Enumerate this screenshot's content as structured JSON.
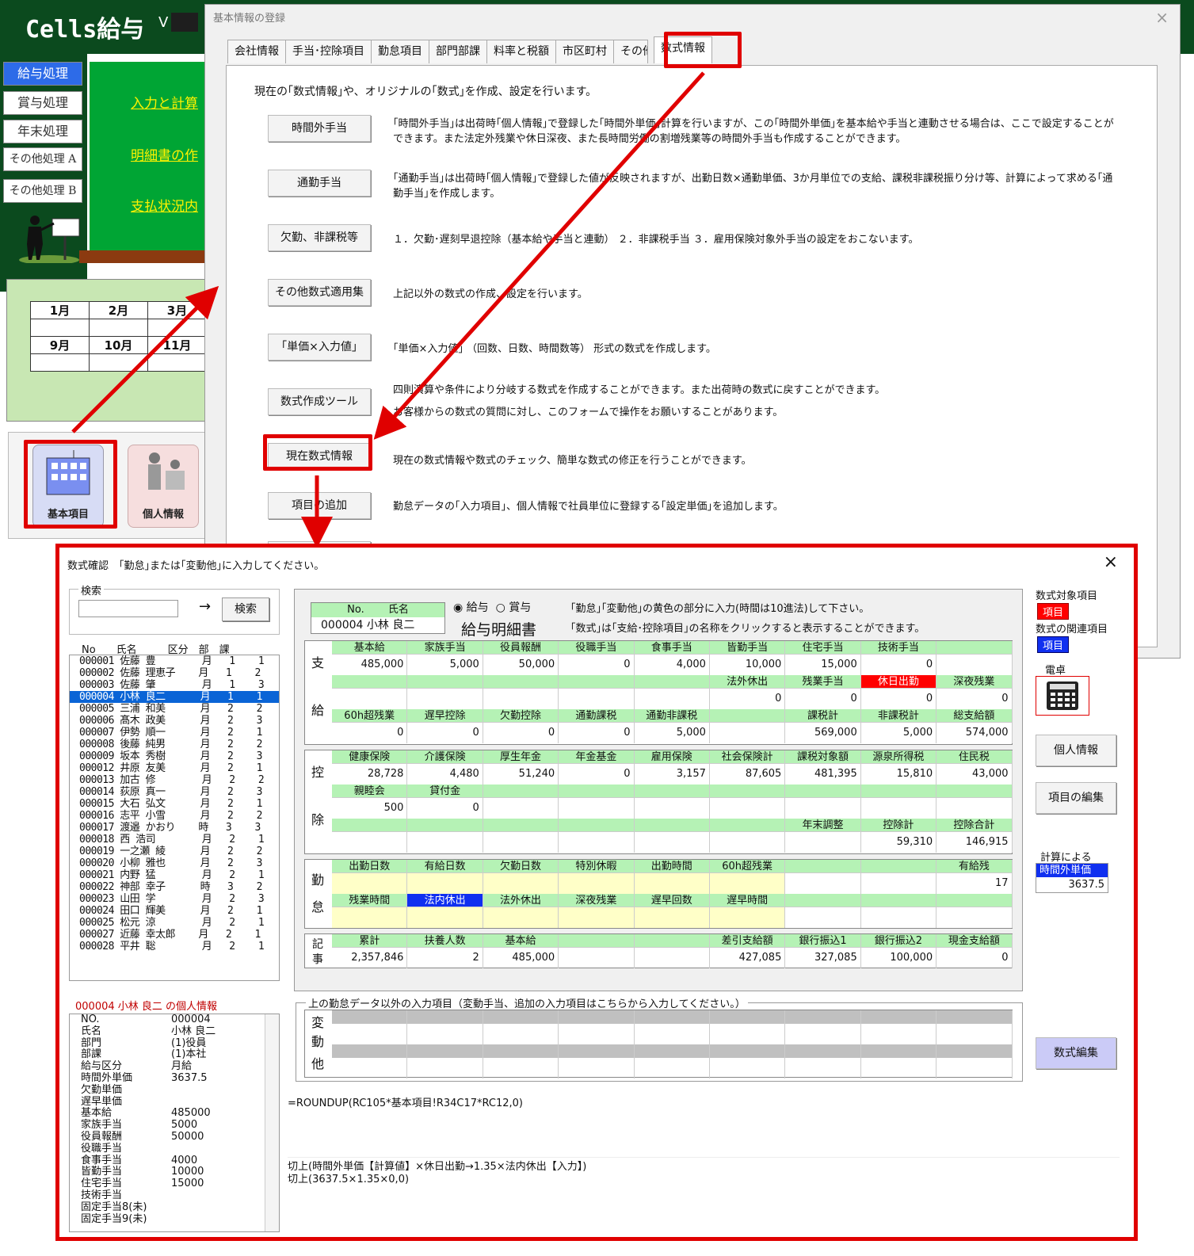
{
  "background_app": {
    "title": "Cells給与",
    "version": "V",
    "menu": [
      "給与処理",
      "賞与処理",
      "年末処理",
      "その他処理 A",
      "その他処理 B"
    ],
    "links": [
      "入力と計算",
      "明細書の作",
      "支払状況内"
    ],
    "calendar": {
      "row1": [
        "1月",
        "2月",
        "3月"
      ],
      "row2": [
        "9月",
        "10月",
        "11月"
      ]
    },
    "icons": {
      "kihon": "基本項目",
      "kojin": "個人情報"
    }
  },
  "dialog_main": {
    "title": "基本情報の登録",
    "close": "×",
    "tabs": [
      "会社情報",
      "手当･控除項目",
      "勤怠項目",
      "部門部課",
      "料率と税額",
      "市区町村",
      "その他",
      "数式情報"
    ],
    "intro": "現在の｢数式情報｣や、オリジナルの｢数式｣を作成、設定を行います。",
    "rows": [
      {
        "button": "時間外手当",
        "desc": "｢時間外手当｣は出荷時｢個人情報｣で登録した｢時間外単価｣計算を行いますが、この｢時間外単価｣を基本給や手当と連動させる場合は、ここで設定することができます。また法定外残業や休日深夜、また長時間労働の割増残業等の時間外手当も作成することができます。"
      },
      {
        "button": "通勤手当",
        "desc": "｢通勤手当｣は出荷時｢個人情報｣で登録した値が反映されますが、出勤日数×通勤単価、3か月単位での支給、課税非課税振り分け等、計算によって求める｢通勤手当｣を作成します。"
      },
      {
        "button": "欠勤、非課税等",
        "desc": "１．欠勤･遅刻早退控除（基本給や手当と連動） ２．非課税手当 ３．雇用保険対象外手当の設定をおこないます。"
      },
      {
        "button": "その他数式適用集",
        "desc": "上記以外の数式の作成、設定を行います。"
      },
      {
        "button": "｢単価×入力値｣",
        "desc": "｢単価×入力値｣ （回数、日数、時間数等） 形式の数式を作成します。"
      },
      {
        "button": "数式作成ツール",
        "desc": "四則演算や条件により分岐する数式を作成することができます。また出荷時の数式に戻すことができます。",
        "desc2": "お客様からの数式の質問に対し、このフォームで操作をお願いすることがあります。"
      },
      {
        "button": "現在数式情報",
        "desc": "現在の数式情報や数式のチェック、簡単な数式の修正を行うことができます。"
      },
      {
        "button": "項目の追加",
        "desc": "勤怠データの｢入力項目｣、個人情報で社員単位に登録する｢設定単価｣を追加します。"
      }
    ]
  },
  "dialog_formula": {
    "title": "数式確認　｢勤怠｣または｢変動他｣に入力してください。",
    "close": "×",
    "search": {
      "label": "検索",
      "arrow": "→",
      "button": "検索",
      "value": ""
    },
    "list_header": "No　　氏名　　　区分　部　課",
    "employees": [
      "000001 佐藤 豊        月   1    1",
      "000002 佐藤 理恵子    月   1    2",
      "000003 佐藤 肇        月   1    3",
      "000004 小林 良二      月   1    1",
      "000005 三浦 和美      月   2    2",
      "000006 髙木 政美      月   2    3",
      "000007 伊勢 順一      月   2    1",
      "000008 後藤 純男      月   2    2",
      "000009 坂本 秀樹      月   2    3",
      "000012 井原 友美      月   2    1",
      "000013 加古 修        月   2    2",
      "000014 荻原 真一      月   2    3",
      "000015 大石 弘文      月   2    1",
      "000016 志平 小雪      月   2    2",
      "000017 渡邉 かおり    時   3    3",
      "000018 西 浩司        月   2    1",
      "000019 一之瀬 綾      月   2    2",
      "000020 小柳 雅也      月   2    3",
      "000021 内野 猛        月   2    1",
      "000022 神部 幸子      時   3    2",
      "000023 山田 学        月   2    3",
      "000024 田口 輝美      月   2    1",
      "000025 松元 涼        月   2    1",
      "000027 近藤 幸太郎    月   2    1",
      "000028 平井 聡        月   2    1"
    ],
    "selected_index": 3,
    "person_title": "000004 小林 良二 の個人情報",
    "person_info": [
      [
        "NO.",
        "000004"
      ],
      [
        "氏名",
        "小林 良二"
      ],
      [
        "部門",
        "(1)役員"
      ],
      [
        "部課",
        "(1)本社"
      ],
      [
        "給与区分",
        "月給"
      ],
      [
        "時間外単価",
        "3637.5"
      ],
      [
        "欠勤単価",
        ""
      ],
      [
        "遅早単価",
        ""
      ],
      [
        "基本給",
        "485000"
      ],
      [
        "家族手当",
        "5000"
      ],
      [
        "役員報酬",
        "50000"
      ],
      [
        "役職手当",
        ""
      ],
      [
        "食事手当",
        "4000"
      ],
      [
        "皆勤手当",
        "10000"
      ],
      [
        "住宅手当",
        "15000"
      ],
      [
        "技術手当",
        ""
      ],
      [
        "固定手当8(未)",
        ""
      ],
      [
        "固定手当9(未)",
        ""
      ]
    ],
    "slip": {
      "no_header": "No.　　 氏名",
      "no_value": "000004 小林 良二",
      "radio_salary": "給与",
      "radio_bonus": "賞与",
      "title": "給与明細書",
      "note1": "｢勤怠｣｢変動他｣の黄色の部分に入力(時間は10進法)して下さい。",
      "note2": "｢数式｣は｢支給･控除項目｣の名称をクリックすると表示することができます。",
      "shikyu_label": [
        "支",
        "給"
      ],
      "shikyu": [
        [
          [
            "基本給",
            "485,000"
          ],
          [
            "家族手当",
            "5,000"
          ],
          [
            "役員報酬",
            "50,000"
          ],
          [
            "役職手当",
            "0"
          ],
          [
            "食事手当",
            "4,000"
          ],
          [
            "皆勤手当",
            "10,000"
          ],
          [
            "住宅手当",
            "15,000"
          ],
          [
            "技術手当",
            "0"
          ],
          [
            "",
            ""
          ]
        ],
        [
          [
            "",
            ""
          ],
          [
            "",
            ""
          ],
          [
            "",
            ""
          ],
          [
            "",
            ""
          ],
          [
            "",
            ""
          ],
          [
            "法外休出",
            "0"
          ],
          [
            "残業手当",
            "0"
          ],
          [
            "休日出勤",
            "0"
          ],
          [
            "深夜残業",
            "0"
          ]
        ],
        [
          [
            "60h超残業",
            "0"
          ],
          [
            "遅早控除",
            "0"
          ],
          [
            "欠勤控除",
            "0"
          ],
          [
            "通勤課税",
            "0"
          ],
          [
            "通勤非課税",
            "5,000"
          ],
          [
            "",
            ""
          ],
          [
            "課税計",
            "569,000"
          ],
          [
            "非課税計",
            "5,000"
          ],
          [
            "総支給額",
            "574,000"
          ]
        ]
      ],
      "kojo_label": [
        "控",
        "除"
      ],
      "kojo": [
        [
          [
            "健康保険",
            "28,728"
          ],
          [
            "介護保険",
            "4,480"
          ],
          [
            "厚生年金",
            "51,240"
          ],
          [
            "年金基金",
            "0"
          ],
          [
            "雇用保険",
            "3,157"
          ],
          [
            "社会保険計",
            "87,605"
          ],
          [
            "課税対象額",
            "481,395"
          ],
          [
            "源泉所得税",
            "15,810"
          ],
          [
            "住民税",
            "43,000"
          ]
        ],
        [
          [
            "親睦会",
            "500"
          ],
          [
            "貸付金",
            "0"
          ],
          [
            "",
            ""
          ],
          [
            "",
            ""
          ],
          [
            "",
            ""
          ],
          [
            "",
            ""
          ],
          [
            "",
            ""
          ],
          [
            "",
            ""
          ],
          [
            "",
            ""
          ]
        ],
        [
          [
            "",
            ""
          ],
          [
            "",
            ""
          ],
          [
            "",
            ""
          ],
          [
            "",
            ""
          ],
          [
            "",
            ""
          ],
          [
            "",
            ""
          ],
          [
            "年末調整",
            ""
          ],
          [
            "控除計",
            "59,310"
          ],
          [
            "控除合計",
            "146,915"
          ]
        ]
      ],
      "kintai_label": [
        "勤",
        "怠"
      ],
      "kintai": [
        [
          [
            "出勤日数",
            ""
          ],
          [
            "有給日数",
            ""
          ],
          [
            "欠勤日数",
            ""
          ],
          [
            "特別休暇",
            ""
          ],
          [
            "出勤時間",
            ""
          ],
          [
            "60h超残業",
            ""
          ],
          [
            "",
            ""
          ],
          [
            "",
            ""
          ],
          [
            "有給残",
            "17"
          ]
        ],
        [
          [
            "残業時間",
            ""
          ],
          [
            "法内休出",
            ""
          ],
          [
            "法外休出",
            ""
          ],
          [
            "深夜残業",
            ""
          ],
          [
            "遅早回数",
            ""
          ],
          [
            "遅早時間",
            ""
          ],
          [
            "",
            ""
          ],
          [
            "",
            ""
          ],
          [
            "",
            ""
          ]
        ]
      ],
      "kiji_label": [
        "記",
        "事"
      ],
      "kiji": [
        [
          [
            "累計",
            "2,357,846"
          ],
          [
            "扶養人数",
            "2"
          ],
          [
            "基本給",
            "485,000"
          ],
          [
            "",
            ""
          ],
          [
            "",
            ""
          ],
          [
            "差引支給額",
            "427,085"
          ],
          [
            "銀行振込1",
            "327,085"
          ],
          [
            "銀行振込2",
            "100,000"
          ],
          [
            "現金支給額",
            "0"
          ]
        ]
      ]
    },
    "henko_title": "上の勤怠データ以外の入力項目（変動手当、追加の入力項目はこちらから入力してください。）",
    "henko_label": [
      "変",
      "動",
      "他"
    ],
    "formula_text": "=ROUNDUP(RC105*基本項目!R34C17*RC12,0)",
    "formula_desc1": "切上(時間外単価【計算値】×休日出勤→1.35×法内休出【入力】)",
    "formula_desc2": "切上(3637.5×1.35×0,0)",
    "right": {
      "target_label": "数式対象項目",
      "target_tag": "項目",
      "related_label": "数式の関連項目",
      "related_tag": "項目",
      "calc_label": "電卓",
      "btn_person": "個人情報",
      "btn_edit": "項目の編集",
      "calc_by": "計算による",
      "calc_item": "時間外単価",
      "calc_value": "3637.5",
      "btn_formula": "数式編集"
    }
  },
  "colors": {
    "header_green": "#0b4a1e",
    "panel_green": "#00a534",
    "highlight_red": "#e00000",
    "cell_green": "#b5f2b5",
    "input_yellow": "#ffffc8"
  }
}
